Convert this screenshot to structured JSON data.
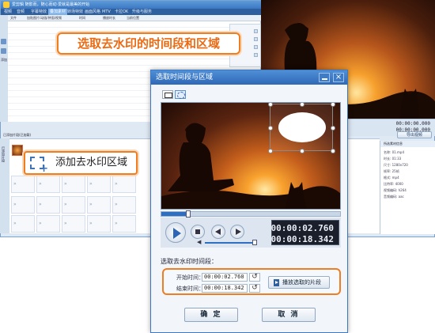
{
  "app": {
    "title": "爱剪辑  随影而，随心而动·爱就是最美的开始",
    "menu": [
      "视频",
      "音频",
      "字幕特效",
      "叠加素材",
      "转场特效",
      "画面风格",
      "MTV",
      "卡拉OK",
      "升级与服务"
    ],
    "active_menu_index": 3,
    "list_headers": [
      "文件",
      "加贴图片/动画/钟面/视频",
      "时间",
      "播放时长",
      "当前位置"
    ],
    "left_add_label": "添加",
    "track_label": "已添加片段(已加载)",
    "track_side_label": "已添加片段",
    "preview_times": [
      "00:00:00.000",
      "00:00:00.000"
    ],
    "export_label": "导出视频",
    "info_title": "所选素材信息",
    "info_rows": [
      {
        "k": "名称:",
        "v": "01.mp4"
      },
      {
        "k": "时长:",
        "v": "01:33"
      },
      {
        "k": "尺寸:",
        "v": "1280x720"
      },
      {
        "k": "帧率:",
        "v": "25帧"
      },
      {
        "k": "格式:",
        "v": "mp4"
      },
      {
        "k": "比特率:",
        "v": "4000"
      },
      {
        "k": "视频编码:",
        "v": "h264"
      },
      {
        "k": "音频编码:",
        "v": "aac"
      }
    ]
  },
  "callouts": {
    "top": "选取去水印的时间段和区域",
    "left": "添加去水印区域"
  },
  "dialog": {
    "title": "选取时间段与区域",
    "close": "×",
    "progress": 0.15,
    "volume": 1.0,
    "current_time": "00:00:02.760",
    "total_time": "00:00:18.342",
    "segment_title": "选取去水印时间段：",
    "start_label": "开始时间：",
    "start_value": "00:00:02.760",
    "end_label": "结束时间：",
    "end_value": "00:00:18.342",
    "reset_icon": "reset-time-icon",
    "play_segment_label": "播放选取的片段",
    "ok_label": "确 定",
    "cancel_label": "取 消"
  },
  "colors": {
    "accent_orange": "#ef7d22",
    "title_blue": "#2f68b6",
    "callout_text": "#ec6a12"
  }
}
